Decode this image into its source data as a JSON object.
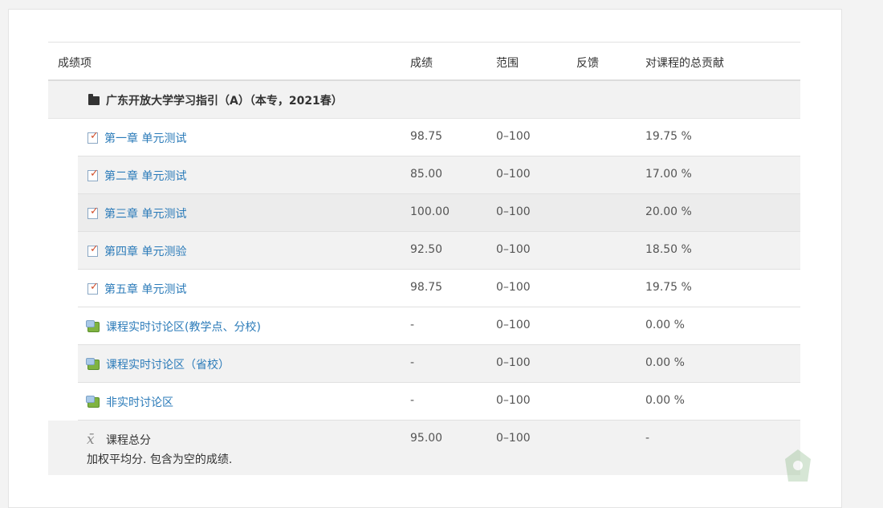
{
  "header": {
    "item": "成绩项",
    "grade": "成绩",
    "range": "范围",
    "feedback": "反馈",
    "contribution": "对课程的总贡献"
  },
  "category": {
    "label": "广东开放大学学习指引（A）（本专，2021春）",
    "icon": "folder-icon"
  },
  "items": [
    {
      "name": "第一章 单元测试",
      "grade": "98.75",
      "range": "0–100",
      "contribution": "19.75 %",
      "icon": "quiz-icon"
    },
    {
      "name": "第二章 单元测试",
      "grade": "85.00",
      "range": "0–100",
      "contribution": "17.00 %",
      "icon": "quiz-icon"
    },
    {
      "name": "第三章 单元测试",
      "grade": "100.00",
      "range": "0–100",
      "contribution": "20.00 %",
      "icon": "quiz-icon"
    },
    {
      "name": "第四章 单元测验",
      "grade": "92.50",
      "range": "0–100",
      "contribution": "18.50 %",
      "icon": "quiz-icon"
    },
    {
      "name": "第五章 单元测试",
      "grade": "98.75",
      "range": "0–100",
      "contribution": "19.75 %",
      "icon": "quiz-icon"
    },
    {
      "name": "课程实时讨论区(教学点、分校)",
      "grade": "-",
      "range": "0–100",
      "contribution": "0.00 %",
      "icon": "forum-icon"
    },
    {
      "name": "课程实时讨论区（省校）",
      "grade": "-",
      "range": "0–100",
      "contribution": "0.00 %",
      "icon": "forum-icon"
    },
    {
      "name": "非实时讨论区",
      "grade": "-",
      "range": "0–100",
      "contribution": "0.00 %",
      "icon": "forum-icon"
    }
  ],
  "total": {
    "label": "课程总分",
    "sublabel": "加权平均分. 包含为空的成绩.",
    "grade": "95.00",
    "range": "0–100",
    "contribution": "-",
    "icon": "calculator-x-icon"
  },
  "colors": {
    "link": "#2b7bb9",
    "row_gray": "#f2f2f2",
    "hover": "#ececec"
  }
}
